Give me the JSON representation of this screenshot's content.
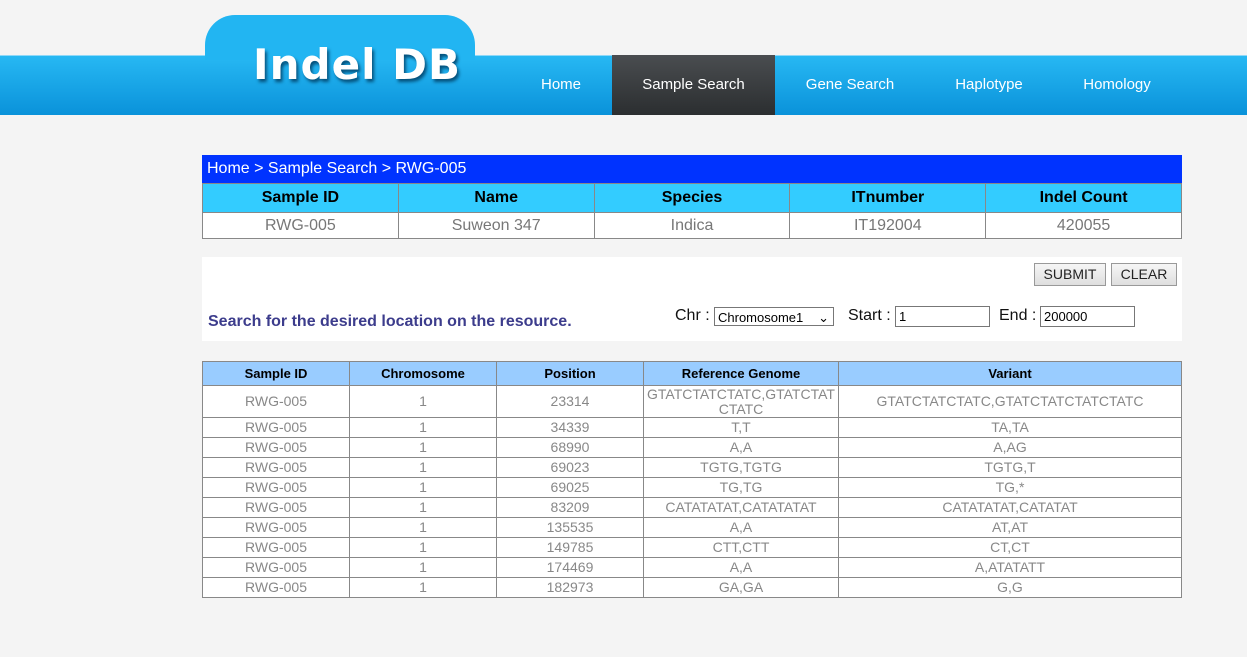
{
  "brand": {
    "logo": "Indel DB"
  },
  "nav": [
    {
      "label": "Home"
    },
    {
      "label": "Sample Search",
      "active": true
    },
    {
      "label": "Gene Search"
    },
    {
      "label": "Haplotype"
    },
    {
      "label": "Homology"
    }
  ],
  "breadcrumb": "Home > Sample Search > RWG-005",
  "info": {
    "headers": [
      "Sample ID",
      "Name",
      "Species",
      "ITnumber",
      "Indel Count"
    ],
    "values": [
      "RWG-005",
      "Suweon 347",
      "Indica",
      "IT192004",
      "420055"
    ]
  },
  "search": {
    "submit": "SUBMIT",
    "clear": "CLEAR",
    "hint": "Search for the desired location on the resource.",
    "chr_label": "Chr :",
    "chr_value": "Chromosome1",
    "start_label": "Start :",
    "start_value": "1",
    "end_label": "End :",
    "end_value": "200000"
  },
  "results": {
    "headers": [
      "Sample ID",
      "Chromosome",
      "Position",
      "Reference Genome",
      "Variant"
    ],
    "rows": [
      [
        "RWG-005",
        "1",
        "23314",
        "GTATCTATCTATC,GTATCTATCTATC",
        "GTATCTATCTATC,GTATCTATCTATCTATC"
      ],
      [
        "RWG-005",
        "1",
        "34339",
        "T,T",
        "TA,TA"
      ],
      [
        "RWG-005",
        "1",
        "68990",
        "A,A",
        "A,AG"
      ],
      [
        "RWG-005",
        "1",
        "69023",
        "TGTG,TGTG",
        "TGTG,T"
      ],
      [
        "RWG-005",
        "1",
        "69025",
        "TG,TG",
        "TG,*"
      ],
      [
        "RWG-005",
        "1",
        "83209",
        "CATATATAT,CATATATAT",
        "CATATATAT,CATATAT"
      ],
      [
        "RWG-005",
        "1",
        "135535",
        "A,A",
        "AT,AT"
      ],
      [
        "RWG-005",
        "1",
        "149785",
        "CTT,CTT",
        "CT,CT"
      ],
      [
        "RWG-005",
        "1",
        "174469",
        "A,A",
        "A,ATATATT"
      ],
      [
        "RWG-005",
        "1",
        "182973",
        "GA,GA",
        "G,G"
      ]
    ]
  },
  "colors": {
    "header_blue": "#1aa6ea",
    "breadcrumb": "#0033ff",
    "info_header": "#33ccff",
    "result_header": "#99ccff",
    "active_nav": "#3a3d40"
  }
}
